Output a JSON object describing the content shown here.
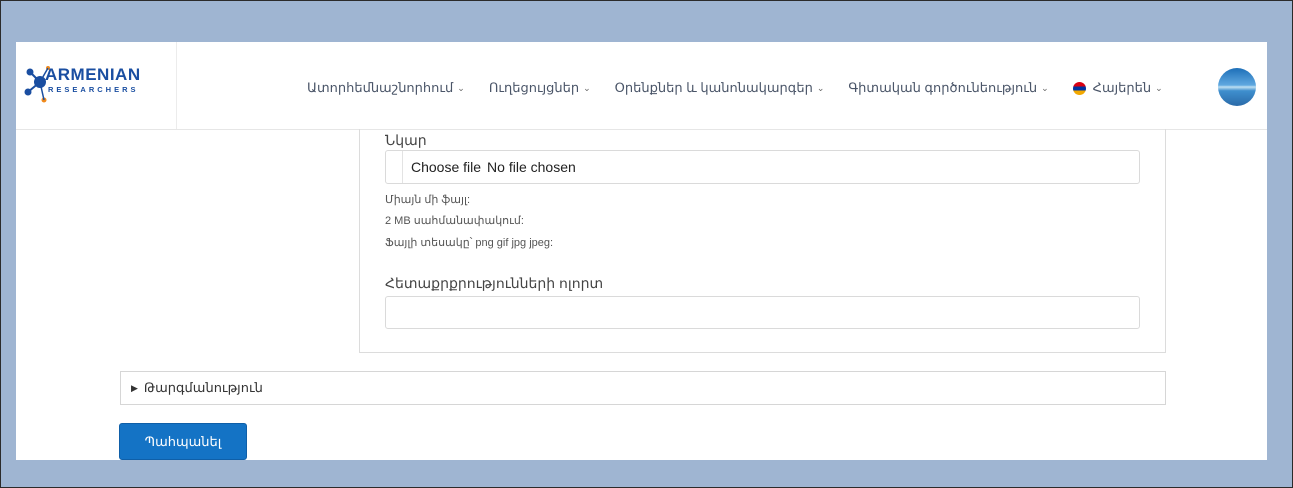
{
  "header": {
    "logo_main": "ARMENIAN",
    "logo_sub": "RESEARCHERS",
    "nav": [
      {
        "label": "Ատորհեմնաշնորհում"
      },
      {
        "label": "Ուղեցույցներ"
      },
      {
        "label": "Օրենքներ և կանոնակարգեր"
      },
      {
        "label": "Գիտական գործունեություն"
      }
    ],
    "language": "Հայերեն"
  },
  "form": {
    "image_label": "Նկար",
    "file_button": "Choose file",
    "file_status": "No file chosen",
    "help_one_file": "Միայն մի ֆայլ:",
    "help_limit": "2 MB սահմանափակում:",
    "help_types": "Ֆայլի տեսակը՝ png gif jpg jpeg:",
    "interests_label": "Հետաքրքրությունների ոլորտ",
    "interests_value": "",
    "translation_summary": "Թարգմանություն",
    "submit_label": "Պահպանել"
  },
  "colors": {
    "background": "#9fb5d2",
    "primary_button": "#1473c5",
    "logo_blue": "#1a4ea1",
    "logo_orange": "#f08a1c"
  }
}
